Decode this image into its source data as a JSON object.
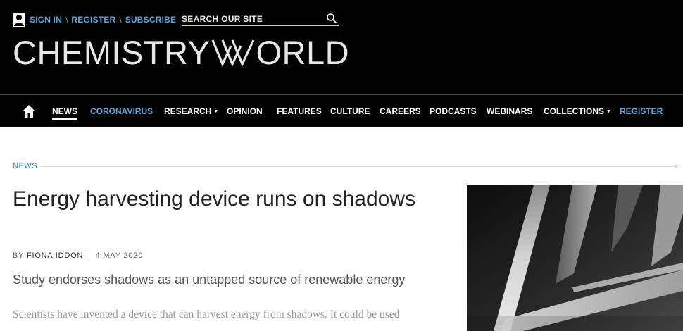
{
  "header": {
    "account": {
      "sign_in": "SIGN IN",
      "register": "REGISTER",
      "subscribe": "SUBSCRIBE",
      "separator": "\\"
    },
    "search": {
      "placeholder": "SEARCH OUR SITE",
      "icon": "search-icon"
    },
    "logo": {
      "part1": "CHEMISTRY",
      "part2": "ORLD"
    }
  },
  "nav": {
    "home_icon": "home-icon",
    "items": [
      {
        "label": "NEWS",
        "accent": false,
        "active": true
      },
      {
        "label": "CORONAVIRUS",
        "accent": true
      },
      {
        "label": "RESEARCH",
        "dropdown": true
      },
      {
        "label": "OPINION"
      },
      {
        "label": "FEATURES"
      },
      {
        "label": "CULTURE"
      },
      {
        "label": "CAREERS"
      },
      {
        "label": "PODCASTS"
      },
      {
        "label": "WEBINARS"
      },
      {
        "label": "COLLECTIONS",
        "dropdown": true
      },
      {
        "label": "REGISTER",
        "accent": true
      }
    ],
    "caret": "▼"
  },
  "article": {
    "section": "NEWS",
    "title": "Energy harvesting device runs on shadows",
    "byline": {
      "prefix": "BY",
      "author": "FIONA IDDON",
      "separator": "|",
      "date": "4 MAY 2020"
    },
    "standfirst": "Study endorses shadows as an untapped source of renewable energy",
    "body_first_line": "Scientists have invented a device that can harvest energy from shadows. It could be used"
  },
  "colors": {
    "accent_blue": "#5aa7dc",
    "section_blue": "#3a82bf",
    "masthead_bg": "#000000"
  }
}
